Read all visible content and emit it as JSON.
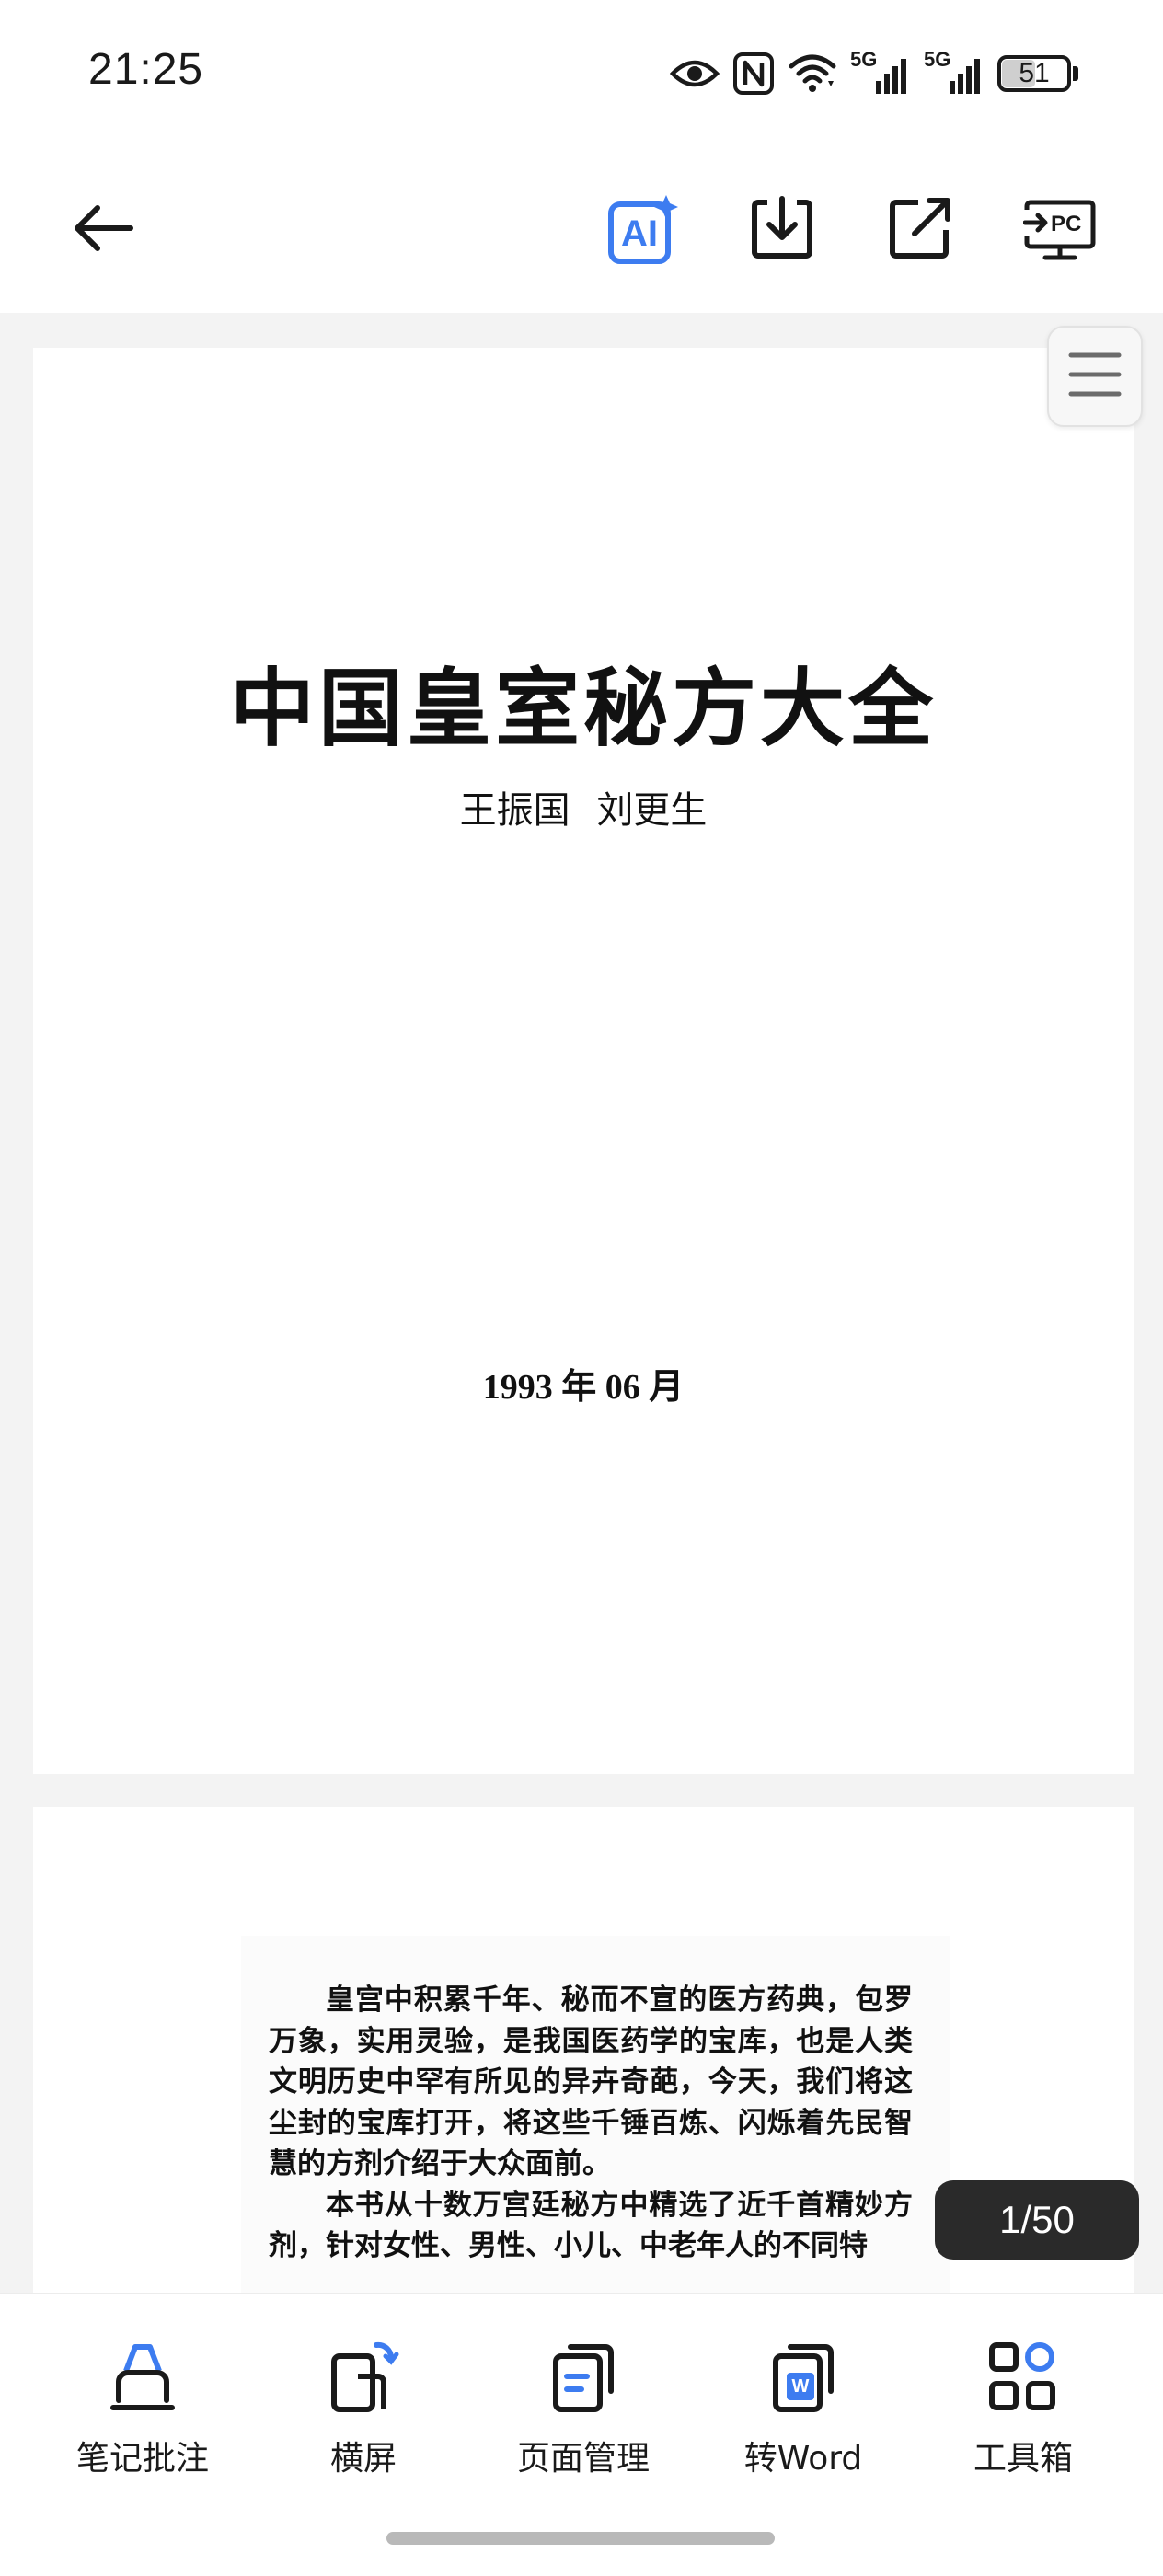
{
  "status_bar": {
    "time": "21:25",
    "network_1": "5G",
    "network_2": "5G",
    "battery_level": 51,
    "battery_text": "51",
    "icons": [
      "eye-icon",
      "nfc-icon",
      "wifi-icon",
      "signal-5g-icon",
      "signal-5g-icon",
      "battery-icon"
    ]
  },
  "toolbar": {
    "icons": [
      "back-arrow-icon",
      "ai-icon",
      "download-icon",
      "share-icon",
      "send-to-pc-icon"
    ],
    "ai_label": "AI",
    "pc_label": "PC",
    "accent_color": "#3d7cf0"
  },
  "document": {
    "page1": {
      "title": "中国皇室秘方大全",
      "authors": "王振国 刘更生",
      "date": "1993 年 06 月"
    },
    "page2": {
      "paragraph_1": "皇宫中积累千年、秘而不宣的医方药典，包罗万象，实用灵验，是我国医药学的宝库，也是人类文明历史中罕有所见的异卉奇葩，今天，我们将这尘封的宝库打开，将这些千锤百炼、闪烁着先民智慧的方剂介绍于大众面前。",
      "paragraph_2": "本书从十数万宫廷秘方中精选了近千首精妙方剂，针对女性、男性、小儿、中老年人的不同特"
    },
    "page_indicator": "1/50",
    "outline_icon": "menu-lines-icon"
  },
  "bottom_bar": {
    "items": [
      {
        "label": "笔记批注",
        "icon": "annotate-icon"
      },
      {
        "label": "横屏",
        "icon": "rotate-screen-icon"
      },
      {
        "label": "页面管理",
        "icon": "page-manage-icon"
      },
      {
        "label": "转Word",
        "icon": "to-word-icon"
      },
      {
        "label": "工具箱",
        "icon": "toolbox-icon"
      }
    ],
    "word_badge": "W"
  }
}
